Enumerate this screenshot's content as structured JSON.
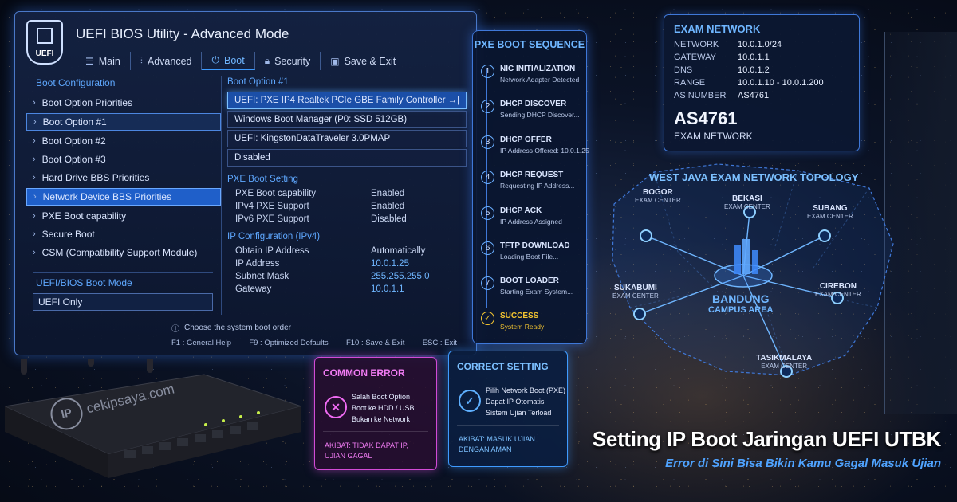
{
  "bios": {
    "logo": "UEFI",
    "title": "UEFI BIOS Utility - Advanced Mode",
    "tabs": [
      {
        "label": "Main",
        "icon": "menu-icon"
      },
      {
        "label": "Advanced",
        "icon": "sliders-icon"
      },
      {
        "label": "Boot",
        "icon": "power-icon",
        "active": true
      },
      {
        "label": "Security",
        "icon": "lock-icon"
      },
      {
        "label": "Save & Exit",
        "icon": "save-icon"
      }
    ],
    "left_heading": "Boot Configuration",
    "left_items": [
      "Boot Option Priorities",
      "Boot Option #1",
      "Boot Option #2",
      "Boot Option #3",
      "Hard Drive BBS Priorities",
      "Network Device BBS Priorities",
      "PXE Boot capability",
      "Secure Boot",
      "CSM (Compatibility Support Module)"
    ],
    "mode_heading": "UEFI/BIOS Boot Mode",
    "mode_value": "UEFI Only",
    "boot_option_heading": "Boot Option #1",
    "boot_options": [
      "UEFI: PXE IP4 Realtek PCIe GBE Family Controller",
      "Windows Boot Manager (P0: SSD 512GB)",
      "UEFI: KingstonDataTraveler 3.0PMAP",
      "Disabled"
    ],
    "pxe_heading": "PXE Boot Setting",
    "pxe_settings": [
      {
        "k": "PXE Boot capability",
        "v": "Enabled"
      },
      {
        "k": "IPv4 PXE Support",
        "v": "Enabled"
      },
      {
        "k": "IPv6 PXE Support",
        "v": "Disabled"
      }
    ],
    "ip_heading": "IP Configuration (IPv4)",
    "ip_settings": [
      {
        "k": "Obtain IP Address",
        "v": "Automatically"
      },
      {
        "k": "IP Address",
        "v": "10.0.1.25"
      },
      {
        "k": "Subnet Mask",
        "v": "255.255.255.0"
      },
      {
        "k": "Gateway",
        "v": "10.0.1.1"
      }
    ],
    "hint": "Choose the system boot order",
    "keys": [
      "F1 : General Help",
      "F9 : Optimized Defaults",
      "F10 : Save & Exit",
      "ESC : Exit"
    ]
  },
  "pxe": {
    "title": "PXE BOOT SEQUENCE",
    "steps": [
      {
        "n": "1",
        "t": "NIC INITIALIZATION",
        "d": "Network Adapter Detected"
      },
      {
        "n": "2",
        "t": "DHCP DISCOVER",
        "d": "Sending DHCP Discover..."
      },
      {
        "n": "3",
        "t": "DHCP OFFER",
        "d": "IP Address Offered: 10.0.1.25"
      },
      {
        "n": "4",
        "t": "DHCP REQUEST",
        "d": "Requesting IP Address..."
      },
      {
        "n": "5",
        "t": "DHCP ACK",
        "d": "IP Address Assigned"
      },
      {
        "n": "6",
        "t": "TFTP DOWNLOAD",
        "d": "Loading Boot File..."
      },
      {
        "n": "7",
        "t": "BOOT LOADER",
        "d": "Starting Exam System..."
      },
      {
        "n": "✓",
        "t": "SUCCESS",
        "d": "System Ready"
      }
    ]
  },
  "network": {
    "title": "EXAM NETWORK",
    "rows": [
      {
        "k": "NETWORK",
        "v": "10.0.1.0/24"
      },
      {
        "k": "GATEWAY",
        "v": "10.0.1.1"
      },
      {
        "k": "DNS",
        "v": "10.0.1.2"
      },
      {
        "k": "RANGE",
        "v": "10.0.1.10 - 10.0.1.200"
      },
      {
        "k": "AS NUMBER",
        "v": "AS4761"
      }
    ],
    "big": "AS4761",
    "sub": "EXAM NETWORK"
  },
  "map": {
    "title": "WEST JAVA  EXAM NETWORK TOPOLOGY",
    "center": {
      "name": "BANDUNG",
      "sub": "CAMPUS AREA"
    },
    "nodes": [
      {
        "name": "BOGOR",
        "sub": "EXAM CENTER"
      },
      {
        "name": "BEKASI",
        "sub": "EXAM CENTER"
      },
      {
        "name": "SUBANG",
        "sub": "EXAM CENTER"
      },
      {
        "name": "SUKABUMI",
        "sub": "EXAM CENTER"
      },
      {
        "name": "CIREBON",
        "sub": "EXAM CENTER"
      },
      {
        "name": "TASIKMALAYA",
        "sub": "EXAM CENTER"
      }
    ]
  },
  "error_card": {
    "title": "COMMON ERROR",
    "lines": [
      "Salah Boot Option",
      "Boot ke HDD / USB",
      "Bukan ke Network"
    ],
    "foot": [
      "AKIBAT: TIDAK DAPAT IP,",
      "UJIAN GAGAL"
    ]
  },
  "ok_card": {
    "title": "CORRECT SETTING",
    "lines": [
      "Pilih Network Boot (PXE)",
      "Dapat IP Otomatis",
      "Sistem Ujian Terload"
    ],
    "foot": [
      "AKIBAT: MASUK UJIAN",
      "DENGAN AMAN"
    ]
  },
  "watermark": {
    "badge": "IP",
    "text": "cekipsaya.com"
  },
  "headline": {
    "title": "Setting IP Boot Jaringan UEFI UTBK",
    "subtitle": "Error di Sini Bisa Bikin Kamu Gagal Masuk Ujian"
  },
  "colors": {
    "accent": "#3d9bff",
    "error": "#d24bd6",
    "success": "#f3c430"
  }
}
